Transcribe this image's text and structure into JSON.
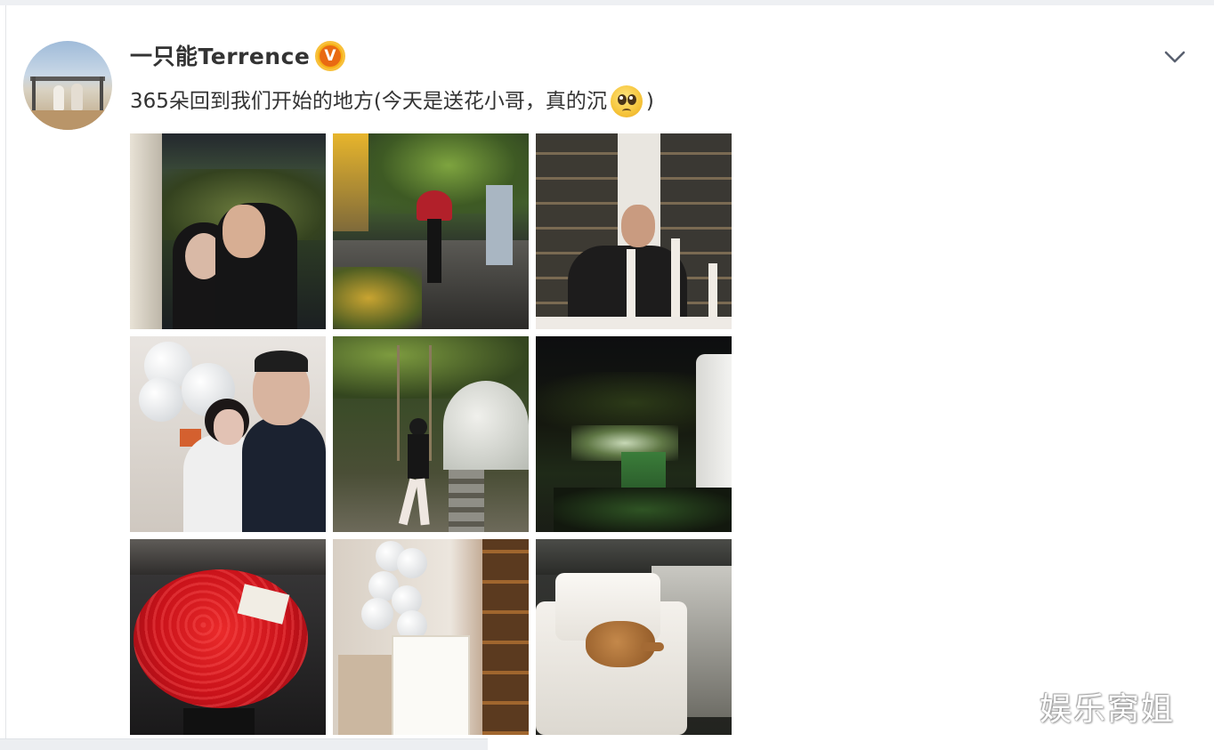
{
  "post": {
    "author": "一只能Terrence",
    "verified_badge": "V",
    "text_before_emoji": "365朵回到我们开始的地方(今天是送花小哥，真的沉",
    "emoji": "pleading-face-emoji",
    "text_after_emoji": " )",
    "menu_icon": "chevron-down-icon"
  },
  "photos": [
    {
      "id": "couple-selfie-night"
    },
    {
      "id": "street-red-umbrella"
    },
    {
      "id": "man-candles-shelf"
    },
    {
      "id": "couple-balloons"
    },
    {
      "id": "woman-swing-dome"
    },
    {
      "id": "garden-night-view"
    },
    {
      "id": "red-roses-bouquet"
    },
    {
      "id": "balloons-anniversary-sign"
    },
    {
      "id": "dog-on-armchair"
    }
  ],
  "watermark": "娱乐窝姐",
  "colors": {
    "text": "#333333",
    "badge_orange": "#e96a12",
    "badge_gold": "#f6b117",
    "background": "#ffffff"
  }
}
